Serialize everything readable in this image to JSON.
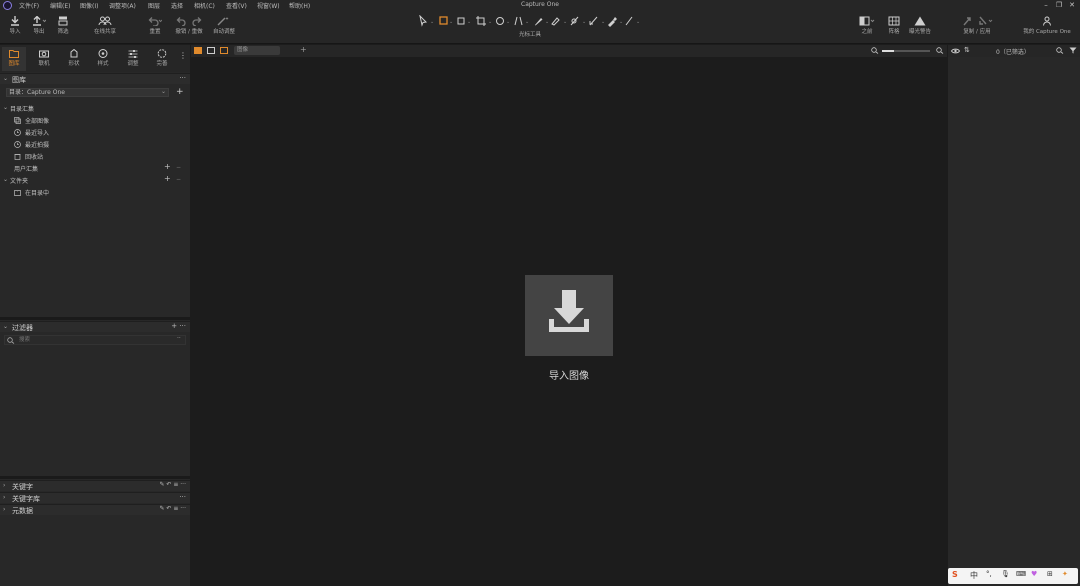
{
  "app": {
    "title": "Capture One"
  },
  "menubar": {
    "items": [
      "文件(F)",
      "编辑(E)",
      "图像(I)",
      "调整项(A)",
      "图层",
      "选择",
      "相机(C)",
      "查看(V)",
      "视窗(W)",
      "帮助(H)"
    ]
  },
  "toolbar": {
    "import_label": "导入",
    "export_label": "导出",
    "filter_label": "筛选",
    "share_label": "在线共享",
    "reset_label": "重置",
    "undo_redo_label": "撤销 / 重做",
    "auto_adjust_label": "自动调整",
    "cursor_tools_label": "光标工具",
    "before_label": "之前",
    "grid_label": "阵格",
    "exposure_label": "曝光警告",
    "copy_apply_label": "复制 / 应用",
    "account_label": "我的 Capture One"
  },
  "left_tabs": [
    "图库",
    "联机",
    "形状",
    "样式",
    "调整",
    "完善"
  ],
  "library": {
    "title": "图库",
    "catalog_select": "目录：Capture One",
    "catalog_collections": "目录汇集",
    "items": [
      "全部图像",
      "最近导入",
      "最近拍摄",
      "回收站"
    ],
    "user_collections": "用户汇集",
    "folders": "文件夹",
    "folder_item": "在目录中"
  },
  "filters": {
    "title": "过滤器",
    "search_placeholder": "搜索"
  },
  "bottom_sections": [
    "关键字",
    "关键字库",
    "元数据"
  ],
  "center": {
    "tab_label": "图像",
    "import_label": "导入图像"
  },
  "right_panel": {
    "count_text": "0（已筛选）"
  },
  "ime": {
    "lang": "中"
  },
  "colors": {
    "accent": "#e08a2c",
    "panel": "#282828",
    "viewer": "#1c1c1c",
    "import_box": "#444444"
  }
}
